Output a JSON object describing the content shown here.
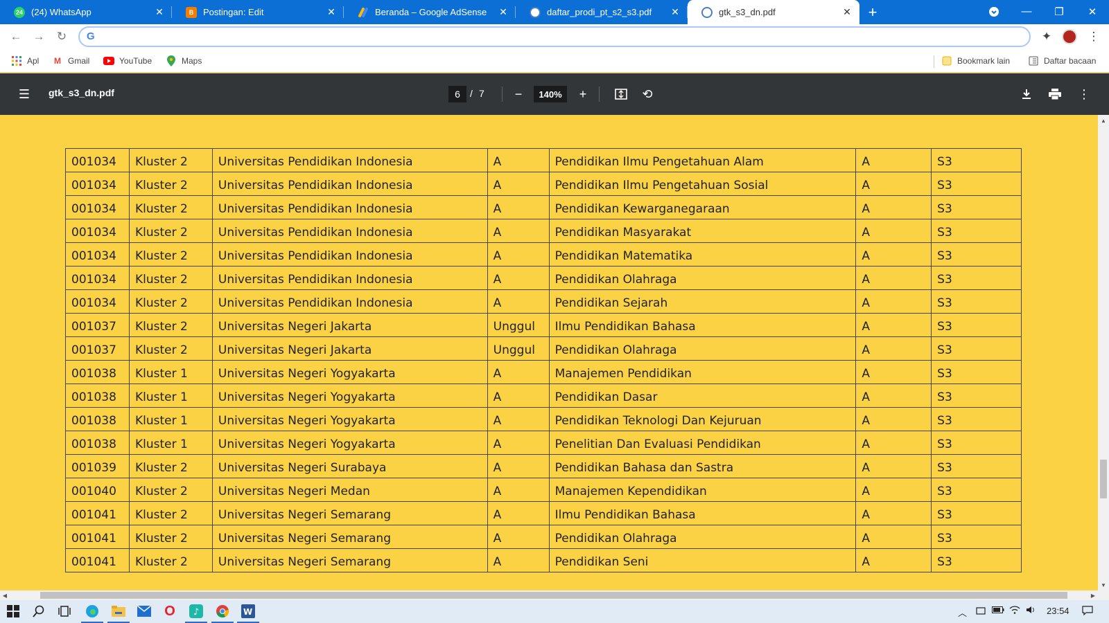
{
  "browser": {
    "tabs": [
      {
        "title": "(24) WhatsApp",
        "icon": "whatsapp-icon",
        "badge": "24",
        "color": "#25d366",
        "active": false
      },
      {
        "title": "Postingan: Edit",
        "icon": "blogger-icon",
        "badge": "B",
        "color": "#f57d00",
        "active": false
      },
      {
        "title": "Beranda – Google AdSense",
        "icon": "adsense-icon",
        "badge": "",
        "color": "#fbbc04",
        "active": false
      },
      {
        "title": "daftar_prodi_pt_s2_s3.pdf",
        "icon": "kemdikbud-icon",
        "badge": "",
        "color": "#4a7fc1",
        "active": false
      },
      {
        "title": "gtk_s3_dn.pdf",
        "icon": "kemdikbud-icon",
        "badge": "",
        "color": "#4a7fc1",
        "active": true
      }
    ],
    "new_tab_label": "+",
    "address": {
      "value": "",
      "placeholder": ""
    },
    "bookmarks": [
      {
        "label": "Apl",
        "icon": "apps-grid-icon"
      },
      {
        "label": "Gmail",
        "icon": "gmail-icon"
      },
      {
        "label": "YouTube",
        "icon": "youtube-icon"
      },
      {
        "label": "Maps",
        "icon": "maps-pin-icon"
      }
    ],
    "bookmarks_right": [
      {
        "label": "Bookmark lain",
        "icon": "folder-icon"
      },
      {
        "label": "Daftar bacaan",
        "icon": "reading-list-icon"
      }
    ]
  },
  "pdf_viewer": {
    "file_name": "gtk_s3_dn.pdf",
    "current_page": "6",
    "page_separator": "/",
    "total_pages": "7",
    "zoom": "140%"
  },
  "table": {
    "rows": [
      [
        "001034",
        "Kluster 2",
        "Universitas Pendidikan Indonesia",
        "A",
        "Pendidikan Ilmu Pengetahuan Alam",
        "A",
        "S3"
      ],
      [
        "001034",
        "Kluster 2",
        "Universitas Pendidikan Indonesia",
        "A",
        "Pendidikan Ilmu Pengetahuan Sosial",
        "A",
        "S3"
      ],
      [
        "001034",
        "Kluster 2",
        "Universitas Pendidikan Indonesia",
        "A",
        "Pendidikan Kewarganegaraan",
        "A",
        "S3"
      ],
      [
        "001034",
        "Kluster 2",
        "Universitas Pendidikan Indonesia",
        "A",
        "Pendidikan Masyarakat",
        "A",
        "S3"
      ],
      [
        "001034",
        "Kluster 2",
        "Universitas Pendidikan Indonesia",
        "A",
        "Pendidikan Matematika",
        "A",
        "S3"
      ],
      [
        "001034",
        "Kluster 2",
        "Universitas Pendidikan Indonesia",
        "A",
        "Pendidikan Olahraga",
        "A",
        "S3"
      ],
      [
        "001034",
        "Kluster 2",
        "Universitas Pendidikan Indonesia",
        "A",
        "Pendidikan Sejarah",
        "A",
        "S3"
      ],
      [
        "001037",
        "Kluster 2",
        "Universitas Negeri Jakarta",
        "Unggul",
        "Ilmu Pendidikan Bahasa",
        "A",
        "S3"
      ],
      [
        "001037",
        "Kluster 2",
        "Universitas Negeri Jakarta",
        "Unggul",
        "Pendidikan Olahraga",
        "A",
        "S3"
      ],
      [
        "001038",
        "Kluster 1",
        "Universitas Negeri Yogyakarta",
        "A",
        "Manajemen Pendidikan",
        "A",
        "S3"
      ],
      [
        "001038",
        "Kluster 1",
        "Universitas Negeri Yogyakarta",
        "A",
        "Pendidikan Dasar",
        "A",
        "S3"
      ],
      [
        "001038",
        "Kluster 1",
        "Universitas Negeri Yogyakarta",
        "A",
        "Pendidikan Teknologi Dan Kejuruan",
        "A",
        "S3"
      ],
      [
        "001038",
        "Kluster 1",
        "Universitas Negeri Yogyakarta",
        "A",
        "Penelitian Dan Evaluasi Pendidikan",
        "A",
        "S3"
      ],
      [
        "001039",
        "Kluster 2",
        "Universitas Negeri Surabaya",
        "A",
        "Pendidikan Bahasa dan Sastra",
        "A",
        "S3"
      ],
      [
        "001040",
        "Kluster 2",
        "Universitas Negeri Medan",
        "A",
        "Manajemen Kependidikan",
        "A",
        "S3"
      ],
      [
        "001041",
        "Kluster 2",
        "Universitas Negeri Semarang",
        "A",
        "Ilmu Pendidikan Bahasa",
        "A",
        "S3"
      ],
      [
        "001041",
        "Kluster 2",
        "Universitas Negeri Semarang",
        "A",
        "Pendidikan Olahraga",
        "A",
        "S3"
      ],
      [
        "001041",
        "Kluster 2",
        "Universitas Negeri Semarang",
        "A",
        "Pendidikan Seni",
        "A",
        "S3"
      ]
    ]
  },
  "taskbar": {
    "apps": [
      "windows-start-icon",
      "search-icon",
      "task-view-icon",
      "edge-icon",
      "file-explorer-icon",
      "mail-icon",
      "opera-icon",
      "tiktok-icon",
      "chrome-icon",
      "word-icon"
    ],
    "clock": "23:54"
  },
  "colors": {
    "page_background": "#fbd243",
    "tabstrip": "#0b6fd6",
    "pdf_toolbar": "#323639"
  }
}
